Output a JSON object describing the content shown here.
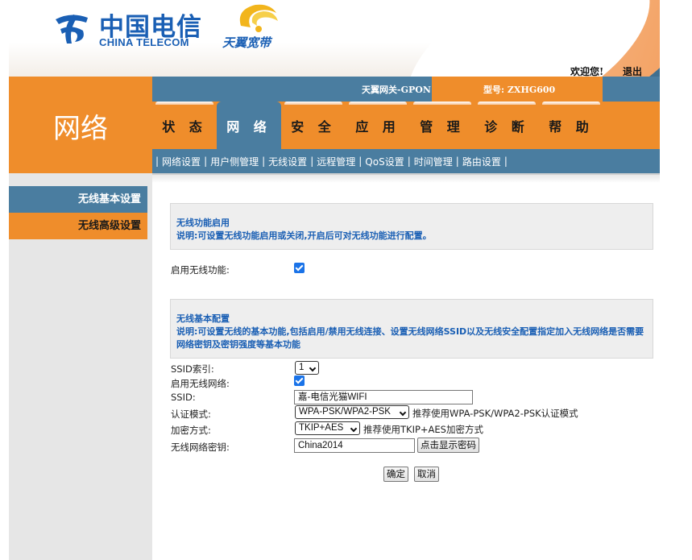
{
  "header": {
    "logo_cn": "中国电信",
    "logo_en": "CHINA TELECOM",
    "brand": "天翼宽带",
    "welcome": "欢迎您!",
    "logout": "退出"
  },
  "nav": {
    "section_title": "网络",
    "gateway_name": "天翼网关-GPON",
    "model": "型号: ZXHG600",
    "tabs": [
      "状 态",
      "网 络",
      "安 全",
      "应 用",
      "管 理",
      "诊 断",
      "帮 助"
    ],
    "active_tab": "网 络",
    "subnav": [
      "网络设置",
      "用户侧管理",
      "无线设置",
      "远程管理",
      "QoS设置",
      "时间管理",
      "路由设置"
    ]
  },
  "sidebar": {
    "items": [
      "无线基本设置",
      "无线高级设置"
    ]
  },
  "section1": {
    "title": "无线功能启用",
    "desc": "说明:可设置无线功能启用或关闭,开启后可对无线功能进行配置。",
    "enable_label": "启用无线功能:",
    "enable_checked": true
  },
  "section2": {
    "title": "无线基本配置",
    "desc": "说明:可设置无线的基本功能,包括启用/禁用无线连接、设置无线网络SSID以及无线安全配置指定加入无线网络是否需要网络密钥及密钥强度等基本功能",
    "ssid_index_label": "SSID索引:",
    "ssid_index_value": "1",
    "enable_wlan_label": "启用无线网络:",
    "enable_wlan_checked": true,
    "ssid_label": "SSID:",
    "ssid_value": "嘉-电信光猫WIFI",
    "auth_label": "认证模式:",
    "auth_value": "WPA-PSK/WPA2-PSK",
    "auth_hint": "推荐使用WPA-PSK/WPA2-PSK认证模式",
    "enc_label": "加密方式:",
    "enc_value": "TKIP+AES",
    "enc_hint": "推荐使用TKIP+AES加密方式",
    "key_label": "无线网络密钥:",
    "key_value": "China2014",
    "show_key_button": "点击显示密码"
  },
  "actions": {
    "ok": "确定",
    "cancel": "取消"
  },
  "colors": {
    "orange": "#ef8d2b",
    "blue": "#4a7da0",
    "link_blue": "#1a5fb4"
  }
}
